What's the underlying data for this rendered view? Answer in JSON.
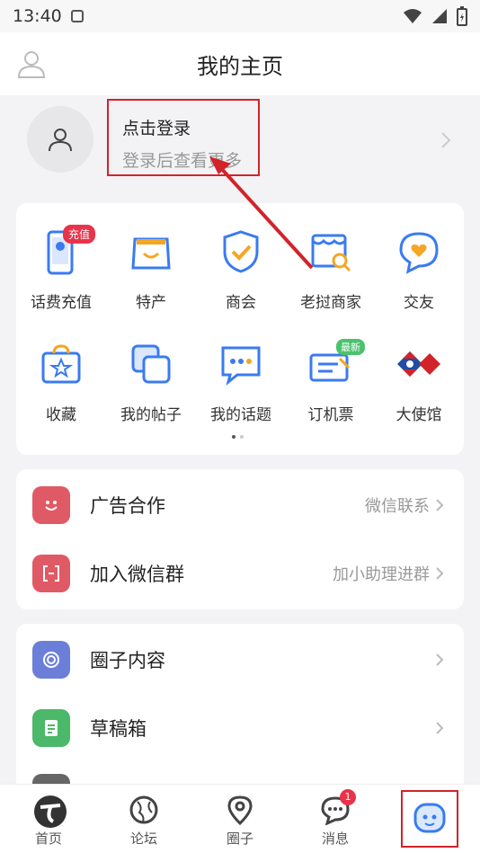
{
  "status": {
    "time": "13:40"
  },
  "header": {
    "title": "我的主页"
  },
  "profile": {
    "login_title": "点击登录",
    "login_subtitle": "登录后查看更多"
  },
  "grid": {
    "items": [
      {
        "label": "话费充值",
        "icon": "phone-topup-icon",
        "badge": "充值"
      },
      {
        "label": "特产",
        "icon": "shopping-bag-icon"
      },
      {
        "label": "商会",
        "icon": "shield-check-icon"
      },
      {
        "label": "老挝商家",
        "icon": "store-search-icon"
      },
      {
        "label": "交友",
        "icon": "heart-chat-icon"
      },
      {
        "label": "收藏",
        "icon": "star-bag-icon"
      },
      {
        "label": "我的帖子",
        "icon": "posts-icon"
      },
      {
        "label": "我的话题",
        "icon": "topic-chat-icon"
      },
      {
        "label": "订机票",
        "icon": "ticket-icon",
        "badge": "最新"
      },
      {
        "label": "大使馆",
        "icon": "flags-icon"
      }
    ]
  },
  "list1": [
    {
      "title": "广告合作",
      "right": "微信联系"
    },
    {
      "title": "加入微信群",
      "right": "加小助理进群"
    }
  ],
  "list2": [
    {
      "title": "圈子内容"
    },
    {
      "title": "草稿箱"
    }
  ],
  "tabbar": {
    "tabs": [
      {
        "label": "首页"
      },
      {
        "label": "论坛"
      },
      {
        "label": "圈子"
      },
      {
        "label": "消息",
        "badge": "1"
      }
    ]
  },
  "colors": {
    "accent_red": "#d2232a",
    "icon_blue": "#3a7bf0",
    "icon_orange": "#f5a623"
  }
}
